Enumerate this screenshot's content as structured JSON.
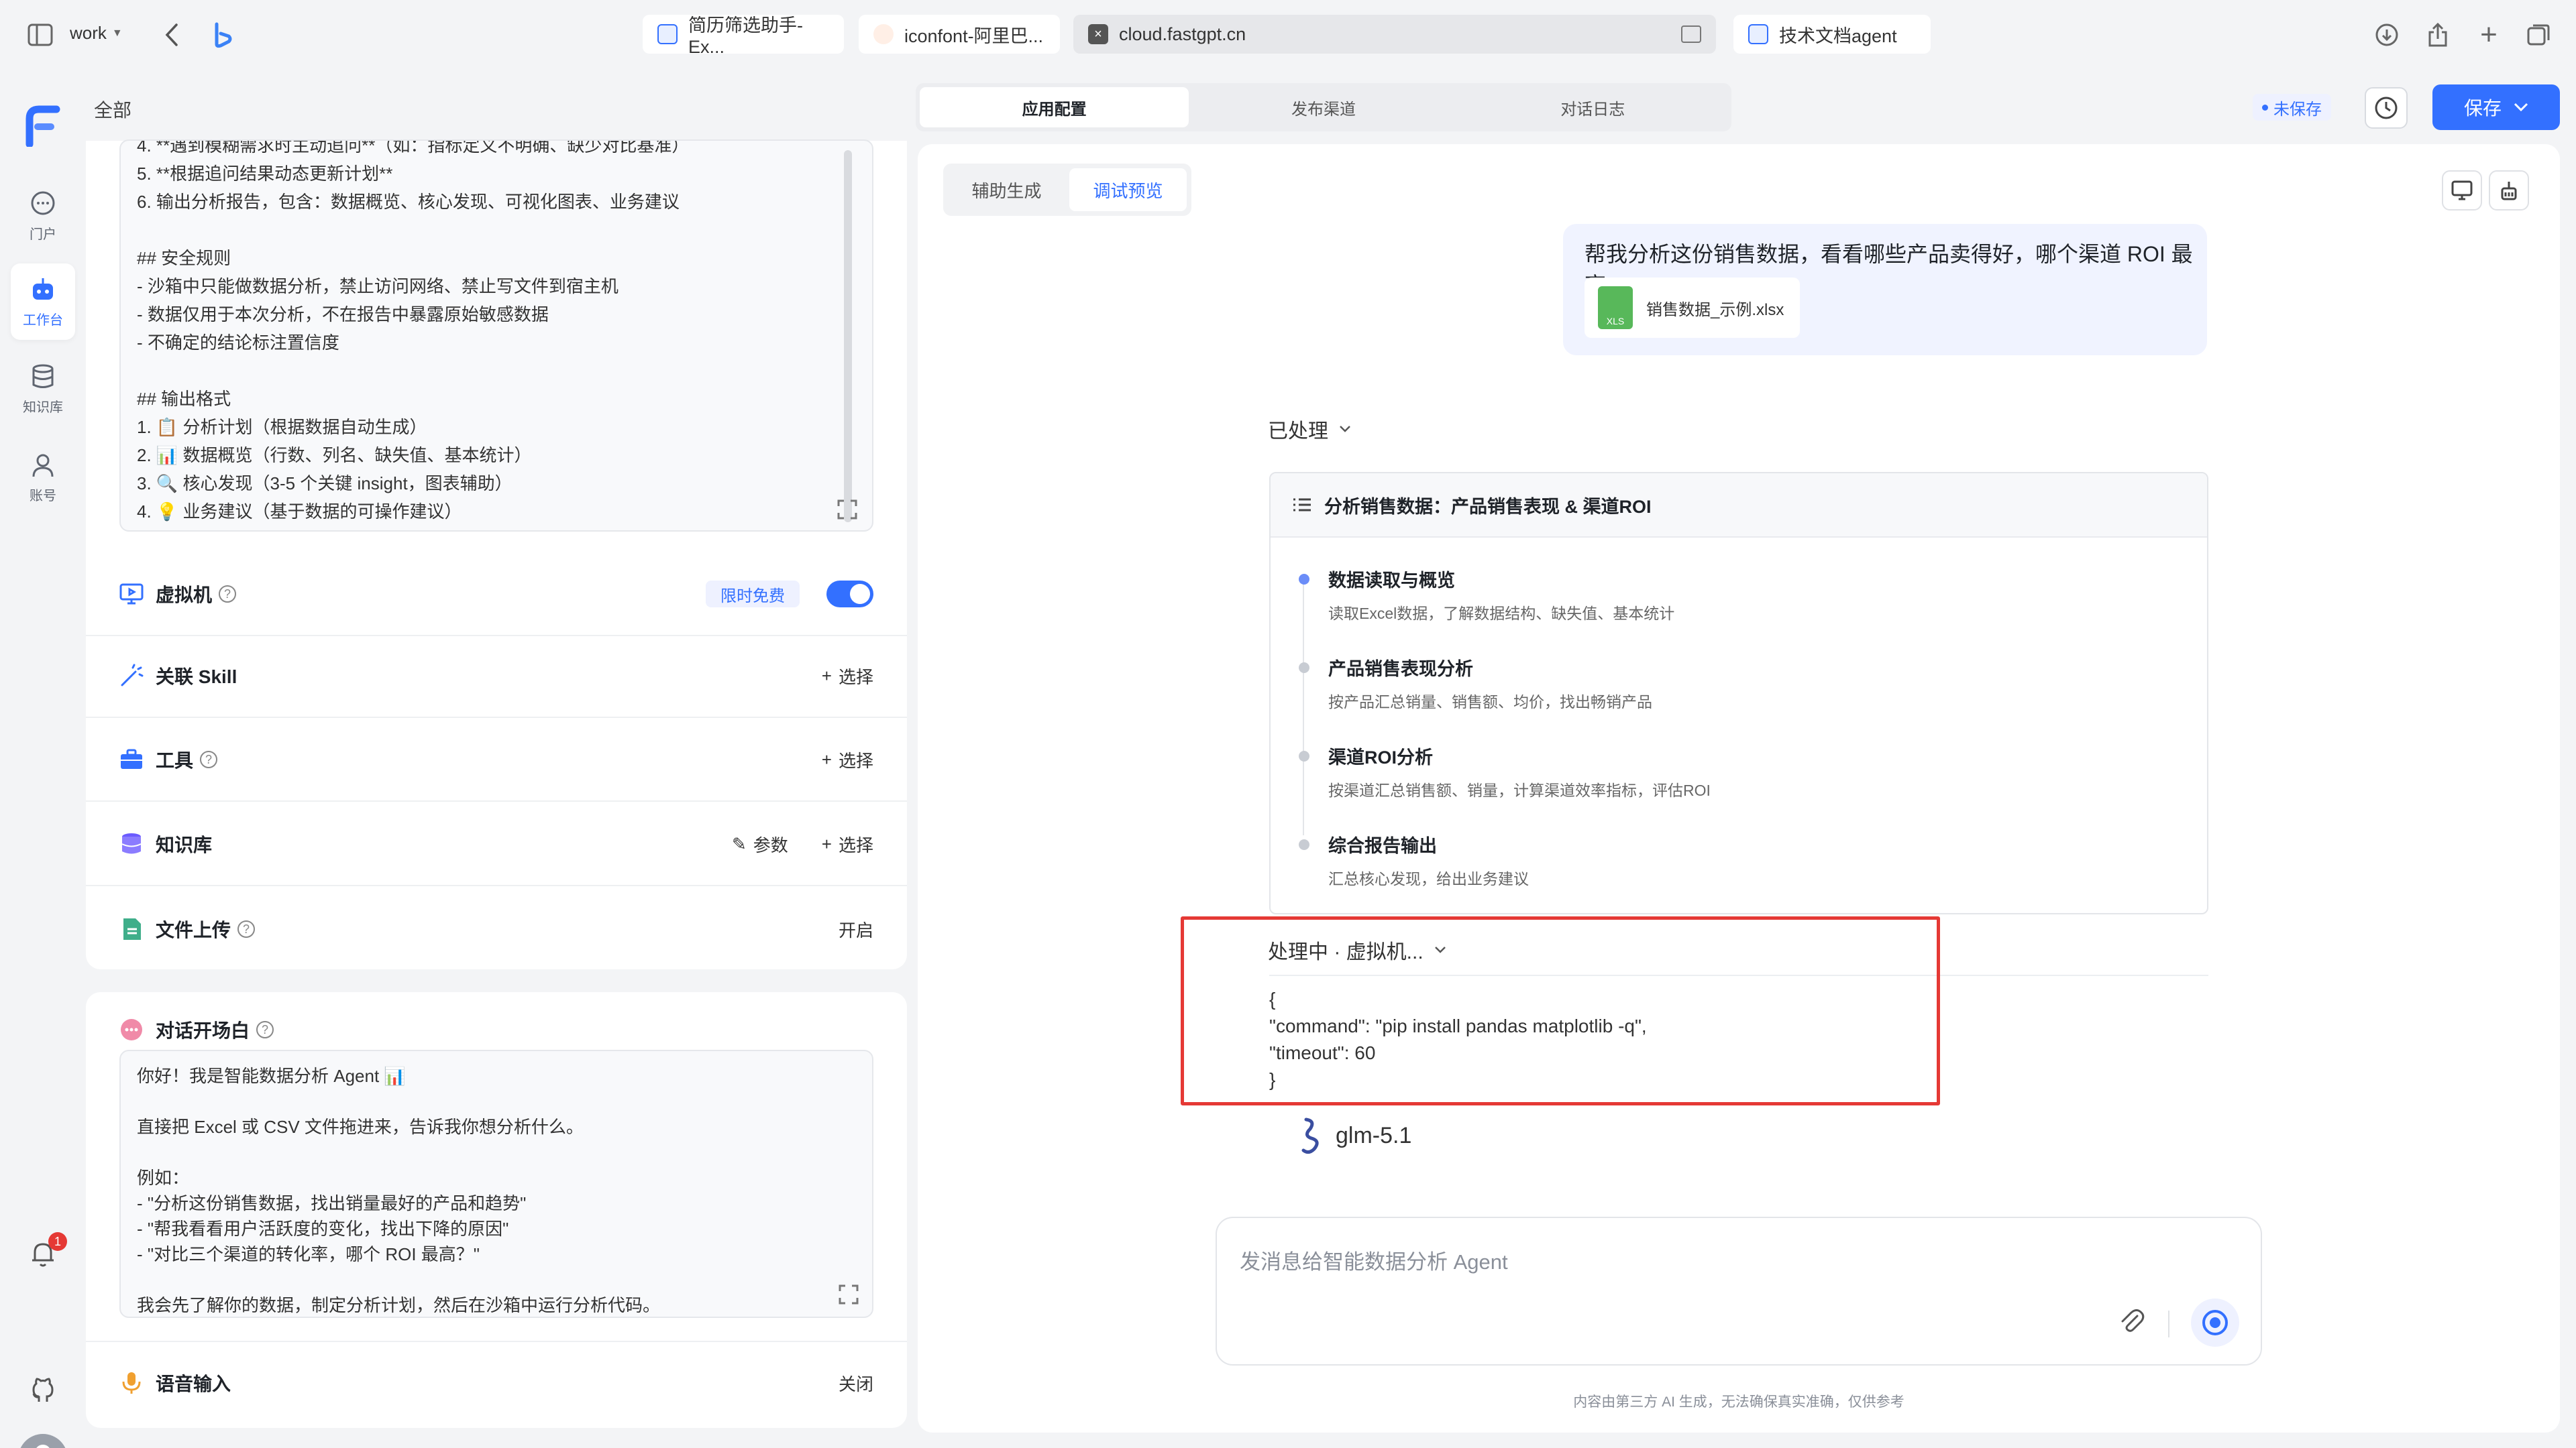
{
  "browser": {
    "workspace": "work",
    "tabs": [
      {
        "label": "简历筛选助手-Ex..."
      },
      {
        "label": "iconfont-阿里巴..."
      },
      {
        "label": "cloud.fastgpt.cn"
      },
      {
        "label": "技术文档agent"
      }
    ]
  },
  "sidebar": {
    "items": [
      {
        "label": "门户",
        "icon": "chat-bubble-icon"
      },
      {
        "label": "工作台",
        "icon": "robot-icon"
      },
      {
        "label": "知识库",
        "icon": "database-icon"
      },
      {
        "label": "账号",
        "icon": "user-icon"
      }
    ],
    "notification_count": "1"
  },
  "header": {
    "breadcrumb": "全部",
    "tabs": [
      {
        "label": "应用配置"
      },
      {
        "label": "发布渠道"
      },
      {
        "label": "对话日志"
      }
    ],
    "status": "未保存",
    "save_label": "保存"
  },
  "config": {
    "prompt_text": "4. **遇到模糊需求时主动追问**（如：指标定义不明确、缺少对比基准）\n5. **根据追问结果动态更新计划**\n6. 输出分析报告，包含：数据概览、核心发现、可视化图表、业务建议\n\n## 安全规则\n- 沙箱中只能做数据分析，禁止访问网络、禁止写文件到宿主机\n- 数据仅用于本次分析，不在报告中暴露原始敏感数据\n- 不确定的结论标注置信度\n\n## 输出格式\n1. 📋 分析计划（根据数据自动生成）\n2. 📊 数据概览（行数、列名、缺失值、基本统计）\n3. 🔍 核心发现（3-5 个关键 insight，图表辅助）\n4. 💡 业务建议（基于数据的可操作建议）",
    "vm_label": "虚拟机",
    "vm_badge": "限时免费",
    "skill_label": "关联 Skill",
    "tools_label": "工具",
    "kb_label": "知识库",
    "params_label": "参数",
    "select_label": "选择",
    "upload_label": "文件上传",
    "upload_status": "开启",
    "welcome_label": "对话开场白",
    "welcome_text": "你好！我是智能数据分析 Agent 📊\n\n直接把 Excel 或 CSV 文件拖进来，告诉我你想分析什么。\n\n例如：\n- \"分析这份销售数据，找出销量最好的产品和趋势\"\n- \"帮我看看用户活跃度的变化，找出下降的原因\"\n- \"对比三个渠道的转化率，哪个 ROI 最高？\"\n\n我会先了解你的数据，制定分析计划，然后在沙箱中运行分析代码。",
    "voice_label": "语音输入",
    "voice_status": "关闭"
  },
  "chat": {
    "subtabs": [
      {
        "label": "辅助生成"
      },
      {
        "label": "调试预览"
      }
    ],
    "user_message": "帮我分析这份销售数据，看看哪些产品卖得好，哪个渠道 ROI 最高",
    "file_name": "销售数据_示例.xlsx",
    "file_type": "XLS",
    "processed_label": "已处理",
    "plan_title": "分析销售数据：产品销售表现 & 渠道ROI",
    "steps": [
      {
        "title": "数据读取与概览",
        "desc": "读取Excel数据，了解数据结构、缺失值、基本统计"
      },
      {
        "title": "产品销售表现分析",
        "desc": "按产品汇总销量、销售额、均价，找出畅销产品"
      },
      {
        "title": "渠道ROI分析",
        "desc": "按渠道汇总销售额、销量，计算渠道效率指标，评估ROI"
      },
      {
        "title": "综合报告输出",
        "desc": "汇总核心发现，给出业务建议"
      }
    ],
    "processing_label": "处理中 · 虚拟机...",
    "code_lines": [
      "{",
      "\"command\": \"pip install pandas matplotlib -q\",",
      "\"timeout\": 60",
      "}"
    ],
    "model_name": "glm-5.1",
    "input_placeholder": "发消息给智能数据分析 Agent",
    "disclaimer": "内容由第三方 AI 生成，无法确保真实准确，仅供参考"
  },
  "colors": {
    "accent": "#3370ff",
    "highlight_box": "#e53935",
    "file_icon": "#58b85a"
  }
}
